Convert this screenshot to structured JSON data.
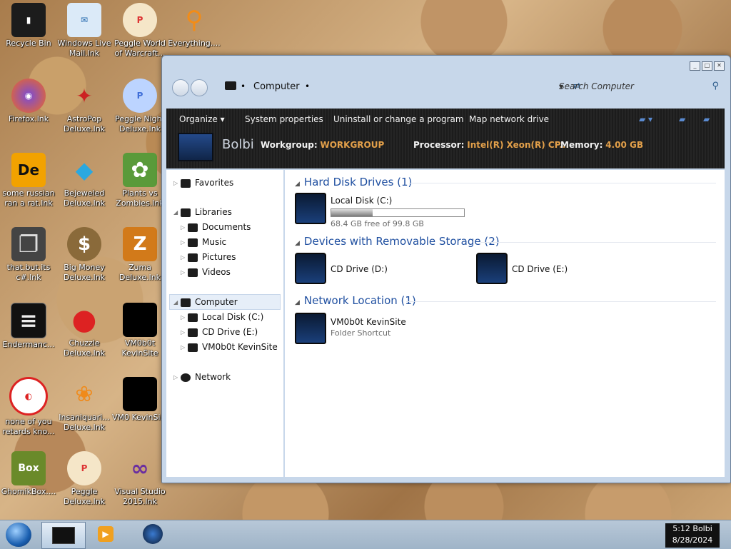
{
  "desktop_icons": [
    {
      "label": "Recycle Bin",
      "glyph": "▮",
      "color": "#1c1c1c"
    },
    {
      "label": "Windows Live Mail.lnk",
      "glyph": "✉",
      "color": "#4a9be0"
    },
    {
      "label": "Peggle World of Warcraft...",
      "glyph": "P",
      "color": "#d33"
    },
    {
      "label": "Everything....",
      "glyph": "⚲",
      "color": "#f28c18"
    },
    {
      "label": "Firefox.lnk",
      "glyph": "◉",
      "color": "#f36b1c"
    },
    {
      "label": "AstroPop Deluxe.lnk",
      "glyph": "✦",
      "color": "#c22"
    },
    {
      "label": "Peggle Night Deluxe.lnk",
      "glyph": "P",
      "color": "#3f6ed8"
    },
    {
      "label": "some russian ran a rat.lnk",
      "glyph": "De",
      "color": "#f2a200"
    },
    {
      "label": "Bejeweled Deluxe.lnk",
      "glyph": "◆",
      "color": "#2aa8e0"
    },
    {
      "label": "Plants vs Zombies.lnk",
      "glyph": "✿",
      "color": "#5a9a3a"
    },
    {
      "label": "that.but.its c#.lnk",
      "glyph": "❐",
      "color": "#444"
    },
    {
      "label": "Big Money Deluxe.lnk",
      "glyph": "$",
      "color": "#8a6a3a"
    },
    {
      "label": "Zuma Deluxe.lnk",
      "glyph": "Z",
      "color": "#d27a1a"
    },
    {
      "label": "Endermanc...",
      "glyph": "≡",
      "color": "#111"
    },
    {
      "label": "Chuzzle Deluxe.lnk",
      "glyph": "●",
      "color": "#d22"
    },
    {
      "label": "VM0b0t KevinSite",
      "glyph": "■",
      "color": "#000"
    },
    {
      "label": "none of you retards kno...",
      "glyph": "◐",
      "color": "#d22"
    },
    {
      "label": "Insaniquari... Deluxe.lnk",
      "glyph": "❀",
      "color": "#f08a1a"
    },
    {
      "label": "VM0 KevinSi...",
      "glyph": "■",
      "color": "#000"
    },
    {
      "label": "GhomikBox....",
      "glyph": "Box",
      "color": "#6a8a2a"
    },
    {
      "label": "Peggle Deluxe.lnk",
      "glyph": "P",
      "color": "#d33"
    },
    {
      "label": "Visual Studio 2015.lnk",
      "glyph": "∞",
      "color": "#6a2ea0"
    }
  ],
  "window": {
    "address": "Computer",
    "search_placeholder": "Search Computer",
    "toolbar": {
      "organize": "Organize ▾",
      "system_properties": "System properties",
      "uninstall": "Uninstall or change a program",
      "map_drive": "Map network drive"
    },
    "details": {
      "name": "Bolbi",
      "workgroup_label": "Workgroup:",
      "workgroup": "WORKGROUP",
      "processor_label": "Processor:",
      "processor": "Intel(R) Xeon(R) CP...",
      "memory_label": "Memory:",
      "memory": "4.00 GB"
    },
    "nav": {
      "favorites": "Favorites",
      "libraries": "Libraries",
      "documents": "Documents",
      "music": "Music",
      "pictures": "Pictures",
      "videos": "Videos",
      "computer": "Computer",
      "local_disk": "Local Disk (C:)",
      "cd_drive": "CD Drive (E:)",
      "vm": "VM0b0t KevinSite",
      "network": "Network"
    },
    "groups": {
      "hdd": "Hard Disk Drives (1)",
      "removable": "Devices with Removable Storage (2)",
      "network": "Network Location (1)"
    },
    "items": {
      "local_disk_name": "Local Disk (C:)",
      "local_disk_free": "68.4 GB free of 99.8 GB",
      "local_disk_used_fraction": 0.31,
      "cd_d": "CD Drive (D:)",
      "cd_e": "CD Drive (E:)",
      "net_name": "VM0b0t KevinSite",
      "net_sub": "Folder Shortcut"
    }
  },
  "taskbar": {
    "time": "5:12 Bolbi",
    "date": "8/28/2024"
  }
}
